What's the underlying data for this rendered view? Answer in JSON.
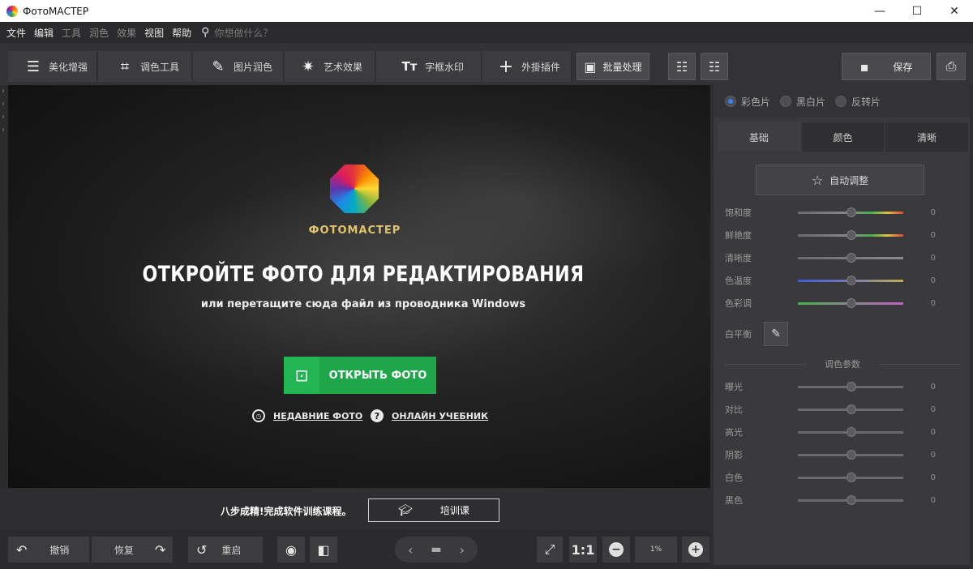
{
  "window": {
    "title": "ФотоМАСТЕР",
    "minimize": "—",
    "maximize": "☐",
    "close": "✕"
  },
  "menu": {
    "items": [
      {
        "label": "文件",
        "dim": false
      },
      {
        "label": "编辑",
        "dim": false
      },
      {
        "label": "工具",
        "dim": true
      },
      {
        "label": "润色",
        "dim": true
      },
      {
        "label": "效果",
        "dim": true
      },
      {
        "label": "视图",
        "dim": false
      },
      {
        "label": "帮助",
        "dim": false
      }
    ],
    "search_placeholder": "你想做什么？"
  },
  "toolbar": {
    "tabs": [
      {
        "label": "美化增强",
        "icon": "sliders-icon",
        "glyph": "☰"
      },
      {
        "label": "调色工具",
        "icon": "crop-icon",
        "glyph": "⌗"
      },
      {
        "label": "图片润色",
        "icon": "brush-icon",
        "glyph": "✎"
      },
      {
        "label": "艺术效果",
        "icon": "magic-wand-icon",
        "glyph": "✷"
      },
      {
        "label": "字框水印",
        "icon": "text-icon",
        "glyph": "Tт"
      },
      {
        "label": "外掛插件",
        "icon": "plus-icon",
        "glyph": "+"
      }
    ],
    "batch_label": "批量处理",
    "save_label": "保存"
  },
  "canvas": {
    "brand": "ФОТОМАСТЕР",
    "headline": "ОТКРОЙТЕ ФОТО ДЛЯ РЕДАКТИРОВАНИЯ",
    "subline": "или перетащите сюда файл из проводника Windows",
    "open_button": "ОТКРЫТЬ ФОТО",
    "recent_link": "НЕДАВНИЕ ФОТО",
    "tutorial_link": "ОНЛАЙН УЧЕБНИК"
  },
  "promo": {
    "text": "八步成精!完成软件训练课程。",
    "button": "培训课"
  },
  "controls": {
    "undo": "撤销",
    "redo": "恢复",
    "reset": "重启",
    "ratio": "1:1",
    "zoom": "1%"
  },
  "right_panel": {
    "modes": [
      {
        "label": "彩色片",
        "selected": true
      },
      {
        "label": "黑白片",
        "selected": false
      },
      {
        "label": "反转片",
        "selected": false
      }
    ],
    "tabs": [
      {
        "label": "基础",
        "active": true
      },
      {
        "label": "颜色",
        "active": false
      },
      {
        "label": "清晰",
        "active": false
      }
    ],
    "auto_adjust": "自动调整",
    "sliders_top": [
      {
        "label": "饱和度",
        "value": "0",
        "gradient": "linear-gradient(90deg,#6a6a6e,#8a8a8e 50%,#46b04a 70%,#e0c040 85%,#d84a3a)"
      },
      {
        "label": "鲜艳度",
        "value": "0",
        "gradient": "linear-gradient(90deg,#6a6a6e,#8a8a8e 50%,#46b04a 70%,#e0c040 85%,#d84a3a)"
      },
      {
        "label": "清晰度",
        "value": "0",
        "gradient": "linear-gradient(90deg,#6a6a6e,#8a8a8e)"
      },
      {
        "label": "色温度",
        "value": "0",
        "gradient": "linear-gradient(90deg,#3a5ad8,#7a7ab0 50%,#c0b050 100%)"
      },
      {
        "label": "色彩调",
        "value": "0",
        "gradient": "linear-gradient(90deg,#46b04a,#8a8a8e 50%,#c060c0 100%)"
      }
    ],
    "white_balance": "白平衡",
    "section_title": "调色参数",
    "sliders_bottom": [
      {
        "label": "曝光",
        "value": "0"
      },
      {
        "label": "对比",
        "value": "0"
      },
      {
        "label": "高光",
        "value": "0"
      },
      {
        "label": "阴影",
        "value": "0"
      },
      {
        "label": "白色",
        "value": "0"
      },
      {
        "label": "黑色",
        "value": "0"
      }
    ]
  }
}
